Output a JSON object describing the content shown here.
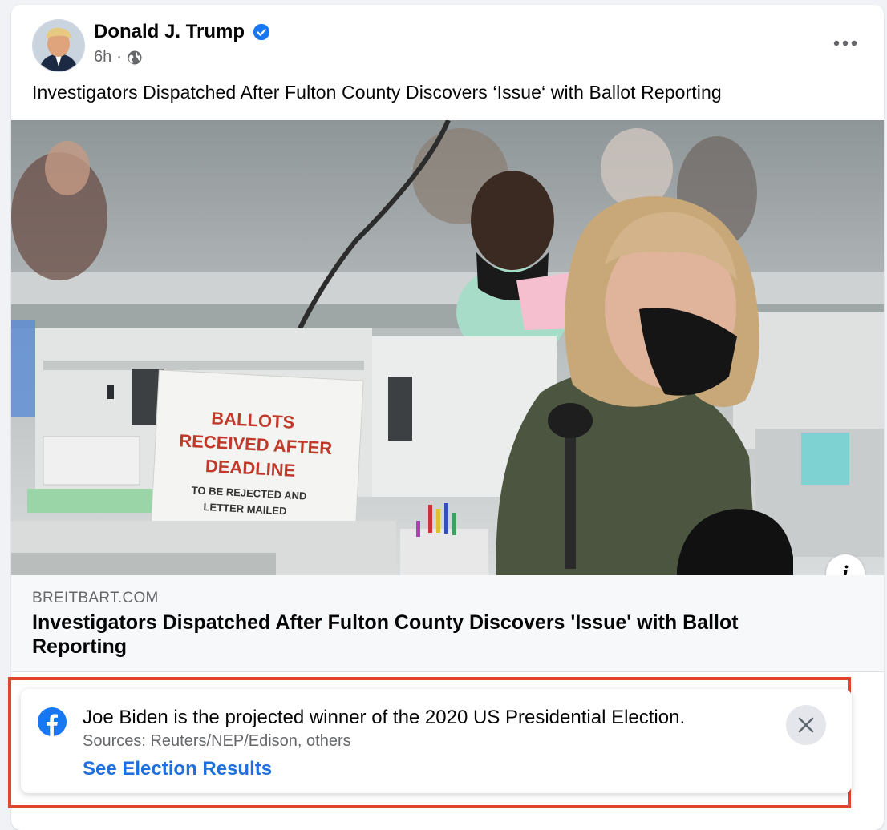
{
  "post": {
    "author": "Donald J. Trump",
    "time": "6h",
    "separator": "·",
    "text": "Investigators Dispatched After Fulton County Discovers ‘Issue‘ with Ballot Reporting"
  },
  "photo": {
    "sign_line1": "BALLOTS",
    "sign_line2": "RECEIVED AFTER",
    "sign_line3": "DEADLINE",
    "sign_line4": "TO BE REJECTED AND",
    "sign_line5": "LETTER MAILED",
    "info_label": "i"
  },
  "link_preview": {
    "domain": "BREITBART.COM",
    "headline": "Investigators Dispatched After Fulton County Discovers 'Issue' with Ballot Reporting"
  },
  "election_notice": {
    "title": "Joe Biden is the projected winner of the 2020 US Presidential Election.",
    "sources": "Sources: Reuters/NEP/Edison, others",
    "link": "See Election Results"
  },
  "colors": {
    "verified_blue": "#1877f2",
    "link_blue": "#216fdb",
    "highlight_red": "#e0462b",
    "sign_red": "#c0392b"
  },
  "icons": [
    "verified-badge-icon",
    "globe-icon",
    "more-options-icon",
    "info-icon",
    "facebook-icon",
    "close-icon"
  ]
}
